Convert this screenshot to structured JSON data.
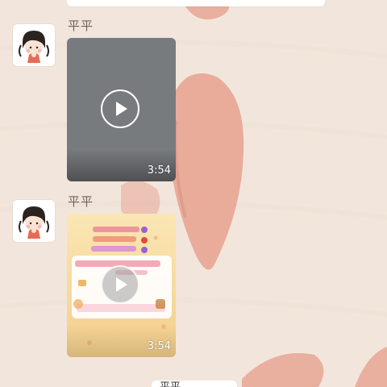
{
  "messages": [
    {
      "sender": "平平",
      "video": {
        "duration": "3:54",
        "style": "gray",
        "thumbnail": "gray-placeholder"
      }
    },
    {
      "sender": "平平",
      "video": {
        "duration": "3:54",
        "style": "thumbnail",
        "thumbnail": "pastel-collage-with-hearts"
      }
    }
  ],
  "next_message": {
    "sender": "平平"
  },
  "colors": {
    "wallpaper": "#f2e6dc",
    "heart": "#e8a594",
    "video_gray": "#787b7e",
    "thumb_bg": "#f5dca2",
    "sender_name": "#6b625c"
  },
  "icons": [
    "play-icon",
    "avatar-girl-icon"
  ]
}
